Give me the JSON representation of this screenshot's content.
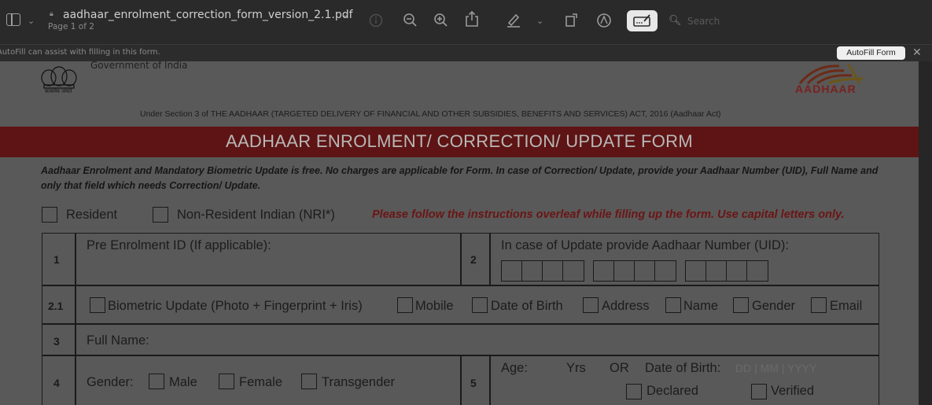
{
  "toolbar": {
    "doc_title": "aadhaar_enrolment_correction_form_version_2.1.pdf",
    "page_indicator": "Page 1 of 2",
    "search_placeholder": "Search"
  },
  "autofill": {
    "message": "AutoFill can assist with filling in this form.",
    "button_label": "AutoFill Form"
  },
  "document": {
    "gov_text": "Government of India",
    "emblem_caption": "सत्यमेव जयते",
    "logo_text": "AADHAAR",
    "act_line": "Under Section 3 of THE AADHAAR (TARGETED DELIVERY OF FINANCIAL AND OTHER SUBSIDIES, BENEFITS AND SERVICES) ACT, 2016 (Aadhaar Act)",
    "form_title": "AADHAAR ENROLMENT/ CORRECTION/ UPDATE FORM",
    "note": "Aadhaar Enrolment and Mandatory Biometric Update is free. No charges are applicable for Form. In case of Correction/ Update, provide your Aadhaar Number (UID), Full Name and only that field which needs Correction/ Update.",
    "resident_label": "Resident",
    "nri_label": "Non-Resident Indian (NRI*)",
    "instruction": "Please follow the instructions overleaf while filling up the form. Use capital letters only.",
    "rows": {
      "r1_num": "1",
      "r1_label": "Pre Enrolment ID (If applicable):",
      "r2_num": "2",
      "r2_label": "In case of Update provide Aadhaar Number (UID):",
      "r21_num": "2.1",
      "opt_biometric": "Biometric Update (Photo + Fingerprint + Iris)",
      "opt_mobile": "Mobile",
      "opt_dob": "Date of Birth",
      "opt_address": "Address",
      "opt_name": "Name",
      "opt_gender": "Gender",
      "opt_email": "Email",
      "r3_num": "3",
      "r3_label": "Full Name:",
      "r4_num": "4",
      "r4_label": "Gender:",
      "male": "Male",
      "female": "Female",
      "transgender": "Transgender",
      "r5_num": "5",
      "age_label": "Age:",
      "yrs": "Yrs",
      "or": "OR",
      "dob_label": "Date of Birth:",
      "dob_placeholder": "DD | MM | YYYY",
      "declared": "Declared",
      "verified": "Verified"
    }
  }
}
